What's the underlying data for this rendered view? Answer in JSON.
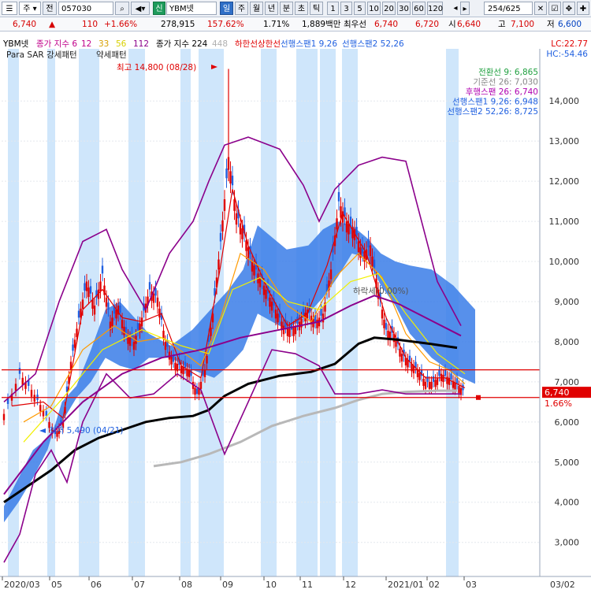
{
  "toolbar": {
    "market": "주",
    "all": "전",
    "code": "057030",
    "sin": "신",
    "name": "YBM넷",
    "periods": [
      "일",
      "주",
      "월",
      "년",
      "분",
      "초",
      "틱"
    ],
    "intervals": [
      "1",
      "3",
      "5",
      "10",
      "20",
      "30",
      "60",
      "120"
    ],
    "page_current": "254",
    "page_total": "/625"
  },
  "quote": {
    "price": "6,740",
    "change_arrow": "▲",
    "change": "110",
    "change_pct": "+1.66%",
    "volume": "278,915",
    "volume_ratio": "157.62%",
    "turnover": "1.71%",
    "amount": "1,889백만",
    "prior_label": "최우선",
    "bid": "6,740",
    "ask": "6,720",
    "open_label": "시",
    "open": "6,640",
    "high_label": "고",
    "high": "7,100",
    "low_label": "저",
    "low": "6,600"
  },
  "legend": {
    "line1": [
      {
        "text": "YBM넷",
        "color": "#000000"
      },
      {
        "text": "종가 지수 6",
        "color": "#c0008a"
      },
      {
        "text": "12",
        "color": "#c0008a"
      },
      {
        "text": "33",
        "color": "#d8a000"
      },
      {
        "text": "56",
        "color": "#d8d000"
      },
      {
        "text": "112",
        "color": "#8b008b"
      },
      {
        "text": "종가 지수 224",
        "color": "#000000"
      },
      {
        "text": "448",
        "color": "#b0b0b0"
      },
      {
        "text": "하한선",
        "color": "#e00000"
      },
      {
        "text": "상한선",
        "color": "#e00000"
      },
      {
        "text": "선행스팬1 9,26",
        "color": "#2060e0"
      },
      {
        "text": "선행스팬2 52,26",
        "color": "#2060e0"
      }
    ],
    "line2": "Para SAR 강세패턴",
    "line2b": "약세패턴",
    "lc": "LC:22.77",
    "hc": "HC:-54.46",
    "ichimoku": [
      {
        "text": "전환선 9: 6,865",
        "color": "#20a040"
      },
      {
        "text": "기준선 26: 7,030",
        "color": "#888888"
      },
      {
        "text": "후행스팬 26: 6,740",
        "color": "#b000b0"
      },
      {
        "text": "선행스팬1 9,26: 6,948",
        "color": "#2060e0"
      },
      {
        "text": "선행스팬2 52,26: 8,725",
        "color": "#2060e0"
      }
    ]
  },
  "annotations": {
    "high": "최고 14,800 (08/28)",
    "low": "최저 5,490 (04/21)",
    "trend": "하락세(0.00%)",
    "current_price": "6,740",
    "current_pct": "1.66%"
  },
  "chart_data": {
    "type": "line",
    "title": "YBM넷 일봉",
    "x_start": "2020/03",
    "x_end": "2021/03",
    "x_tick_labels": [
      "2020/03",
      "05",
      "06",
      "07",
      "08",
      "09",
      "10",
      "11",
      "12",
      "2021/01",
      "02",
      "03"
    ],
    "y_ticks": [
      3000,
      4000,
      5000,
      6000,
      7000,
      8000,
      9000,
      10000,
      11000,
      12000,
      13000,
      14000
    ],
    "ylim": [
      2150,
      15300
    ],
    "high_point": {
      "date": "2020/08/28",
      "value": 14800
    },
    "low_point": {
      "date": "2020/04/21",
      "value": 5490
    },
    "horizontal_lines": [
      7300,
      6610
    ],
    "series": [
      {
        "name": "종가",
        "color": "#e00000",
        "points": [
          [
            0,
            6200
          ],
          [
            4,
            7200
          ],
          [
            7,
            6800
          ],
          [
            10,
            6300
          ],
          [
            13,
            5700
          ],
          [
            15,
            6000
          ],
          [
            17,
            7500
          ],
          [
            19,
            8600
          ],
          [
            21,
            9500
          ],
          [
            23,
            8900
          ],
          [
            25,
            9700
          ],
          [
            27,
            8500
          ],
          [
            29,
            8900
          ],
          [
            31,
            8200
          ],
          [
            33,
            8000
          ],
          [
            35,
            8600
          ],
          [
            37,
            9300
          ],
          [
            39,
            9100
          ],
          [
            41,
            8000
          ],
          [
            43,
            7500
          ],
          [
            45,
            7400
          ],
          [
            47,
            7300
          ],
          [
            49,
            6700
          ],
          [
            51,
            7300
          ],
          [
            53,
            8700
          ],
          [
            55,
            10500
          ],
          [
            57,
            12600
          ],
          [
            59,
            11200
          ],
          [
            61,
            10700
          ],
          [
            63,
            10000
          ],
          [
            65,
            9600
          ],
          [
            67,
            9200
          ],
          [
            69,
            8800
          ],
          [
            71,
            8400
          ],
          [
            73,
            8300
          ],
          [
            75,
            8500
          ],
          [
            77,
            8800
          ],
          [
            79,
            8500
          ],
          [
            81,
            8700
          ],
          [
            83,
            9800
          ],
          [
            85,
            11500
          ],
          [
            87,
            11000
          ],
          [
            89,
            10800
          ],
          [
            91,
            10200
          ],
          [
            93,
            10400
          ],
          [
            95,
            9300
          ],
          [
            97,
            8300
          ],
          [
            99,
            8200
          ],
          [
            101,
            7700
          ],
          [
            103,
            7500
          ],
          [
            105,
            7300
          ],
          [
            107,
            7000
          ],
          [
            109,
            7000
          ],
          [
            111,
            7200
          ],
          [
            113,
            7100
          ],
          [
            115,
            6950
          ],
          [
            117,
            6740
          ]
        ]
      },
      {
        "name": "MA6",
        "color": "#e00000",
        "points": [
          [
            2,
            6400
          ],
          [
            10,
            6500
          ],
          [
            15,
            6100
          ],
          [
            20,
            8800
          ],
          [
            25,
            9300
          ],
          [
            30,
            8600
          ],
          [
            35,
            8500
          ],
          [
            40,
            8700
          ],
          [
            45,
            7400
          ],
          [
            50,
            7100
          ],
          [
            55,
            9900
          ],
          [
            58,
            11800
          ],
          [
            62,
            10400
          ],
          [
            67,
            9300
          ],
          [
            72,
            8400
          ],
          [
            77,
            8700
          ],
          [
            82,
            9900
          ],
          [
            86,
            11200
          ],
          [
            92,
            10200
          ],
          [
            97,
            8600
          ],
          [
            102,
            7600
          ],
          [
            107,
            7100
          ],
          [
            112,
            7100
          ],
          [
            117,
            6850
          ]
        ]
      },
      {
        "name": "MA33",
        "color": "#ff9a00",
        "points": [
          [
            5,
            6000
          ],
          [
            12,
            6400
          ],
          [
            20,
            7800
          ],
          [
            28,
            8400
          ],
          [
            34,
            8000
          ],
          [
            40,
            8100
          ],
          [
            46,
            7700
          ],
          [
            50,
            7400
          ],
          [
            55,
            8600
          ],
          [
            60,
            10200
          ],
          [
            66,
            9800
          ],
          [
            72,
            8900
          ],
          [
            78,
            8500
          ],
          [
            84,
            9600
          ],
          [
            90,
            10200
          ],
          [
            96,
            9600
          ],
          [
            102,
            8200
          ],
          [
            108,
            7500
          ],
          [
            113,
            7300
          ],
          [
            117,
            6950
          ]
        ]
      },
      {
        "name": "MA56",
        "color": "#f2f000",
        "points": [
          [
            5,
            5500
          ],
          [
            15,
            6600
          ],
          [
            25,
            7800
          ],
          [
            35,
            8300
          ],
          [
            45,
            7900
          ],
          [
            52,
            7700
          ],
          [
            58,
            9300
          ],
          [
            65,
            9600
          ],
          [
            72,
            9000
          ],
          [
            80,
            8800
          ],
          [
            88,
            9500
          ],
          [
            95,
            9700
          ],
          [
            102,
            8700
          ],
          [
            110,
            7700
          ],
          [
            117,
            7200
          ]
        ]
      },
      {
        "name": "MA112",
        "color": "#8b008b",
        "points": [
          [
            0,
            4200
          ],
          [
            10,
            5500
          ],
          [
            20,
            6500
          ],
          [
            30,
            7200
          ],
          [
            40,
            7600
          ],
          [
            50,
            7800
          ],
          [
            60,
            8100
          ],
          [
            70,
            8300
          ],
          [
            80,
            8500
          ],
          [
            88,
            8900
          ],
          [
            94,
            9150
          ],
          [
            100,
            8950
          ],
          [
            108,
            8550
          ],
          [
            116,
            8150
          ]
        ]
      },
      {
        "name": "MA224",
        "color": "#000000",
        "points": [
          [
            0,
            4000
          ],
          [
            6,
            4400
          ],
          [
            12,
            4800
          ],
          [
            18,
            5300
          ],
          [
            24,
            5600
          ],
          [
            30,
            5800
          ],
          [
            36,
            6000
          ],
          [
            42,
            6100
          ],
          [
            48,
            6150
          ],
          [
            52,
            6300
          ],
          [
            56,
            6650
          ],
          [
            62,
            6950
          ],
          [
            70,
            7150
          ],
          [
            78,
            7250
          ],
          [
            84,
            7450
          ],
          [
            90,
            7950
          ],
          [
            94,
            8100
          ],
          [
            100,
            8050
          ],
          [
            108,
            7950
          ],
          [
            115,
            7850
          ]
        ]
      },
      {
        "name": "MA448",
        "color": "#b8b8b8",
        "points": [
          [
            38,
            4900
          ],
          [
            45,
            5000
          ],
          [
            52,
            5200
          ],
          [
            60,
            5500
          ],
          [
            68,
            5900
          ],
          [
            76,
            6150
          ],
          [
            84,
            6350
          ],
          [
            90,
            6550
          ],
          [
            96,
            6700
          ],
          [
            102,
            6750
          ],
          [
            110,
            6780
          ],
          [
            115,
            6780
          ]
        ]
      },
      {
        "name": "Envelope upper",
        "color": "#8b008b",
        "points": [
          [
            0,
            6500
          ],
          [
            8,
            7200
          ],
          [
            14,
            9000
          ],
          [
            20,
            10500
          ],
          [
            26,
            10800
          ],
          [
            30,
            9800
          ],
          [
            36,
            8800
          ],
          [
            42,
            10200
          ],
          [
            48,
            11000
          ],
          [
            52,
            12000
          ],
          [
            56,
            12900
          ],
          [
            62,
            13100
          ],
          [
            70,
            12800
          ],
          [
            76,
            11900
          ],
          [
            80,
            11000
          ],
          [
            84,
            11800
          ],
          [
            90,
            12400
          ],
          [
            96,
            12600
          ],
          [
            102,
            12500
          ],
          [
            106,
            11000
          ],
          [
            110,
            9500
          ],
          [
            116,
            8400
          ]
        ]
      },
      {
        "name": "Envelope lower",
        "color": "#8b008b",
        "points": [
          [
            0,
            2500
          ],
          [
            4,
            3200
          ],
          [
            8,
            4700
          ],
          [
            12,
            5300
          ],
          [
            16,
            4500
          ],
          [
            20,
            6000
          ],
          [
            26,
            7200
          ],
          [
            32,
            6600
          ],
          [
            38,
            6700
          ],
          [
            44,
            7200
          ],
          [
            50,
            6800
          ],
          [
            56,
            5200
          ],
          [
            62,
            6500
          ],
          [
            68,
            7800
          ],
          [
            74,
            7700
          ],
          [
            80,
            7400
          ],
          [
            84,
            6700
          ],
          [
            90,
            6700
          ],
          [
            96,
            6800
          ],
          [
            102,
            6700
          ],
          [
            108,
            6700
          ],
          [
            116,
            6700
          ]
        ]
      }
    ]
  }
}
